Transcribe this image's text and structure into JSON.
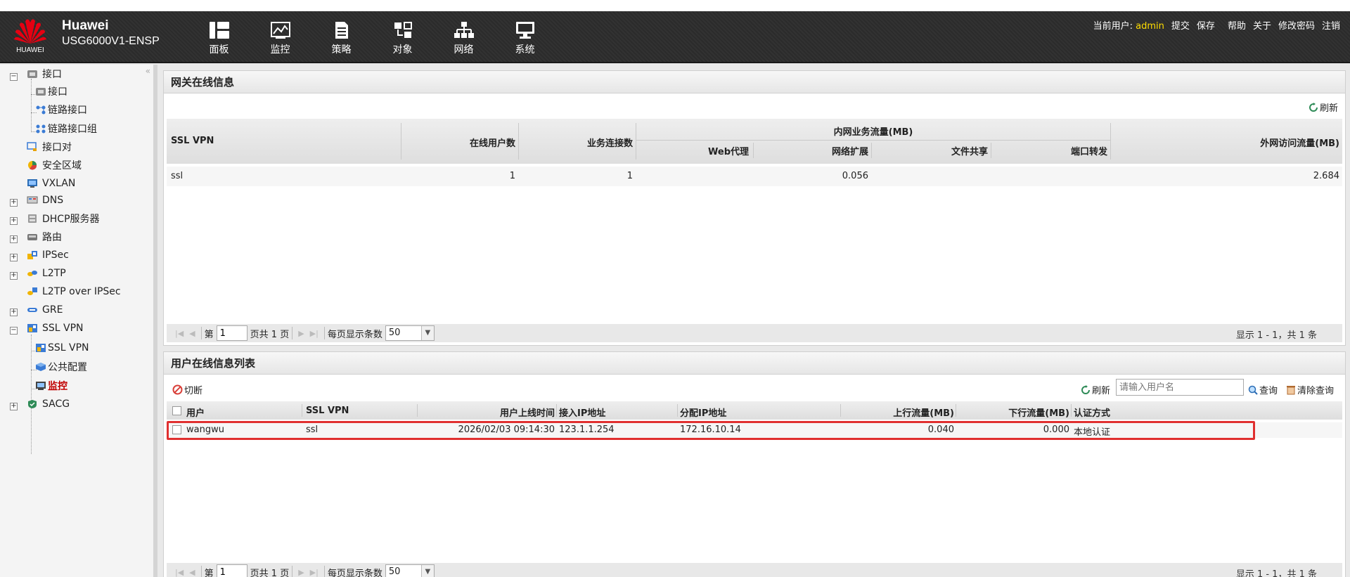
{
  "app": {
    "brand": "Huawei",
    "model": "USG6000V1-ENSP",
    "logo_text": "HUAWEI"
  },
  "nav": [
    {
      "label": "面板",
      "icon": "dashboard-icon"
    },
    {
      "label": "监控",
      "icon": "monitor-icon"
    },
    {
      "label": "策略",
      "icon": "policy-icon"
    },
    {
      "label": "对象",
      "icon": "object-icon"
    },
    {
      "label": "网络",
      "icon": "network-icon"
    },
    {
      "label": "系统",
      "icon": "system-icon"
    }
  ],
  "toplinks": {
    "current_user_label": "当前用户:",
    "username": "admin",
    "submit": "提交",
    "save": "保存",
    "help": "帮助",
    "about": "关于",
    "change_password": "修改密码",
    "logout": "注销"
  },
  "sidebar": {
    "items": [
      {
        "label": "接口"
      },
      {
        "label": "接口"
      },
      {
        "label": "链路接口"
      },
      {
        "label": "链路接口组"
      },
      {
        "label": "接口对"
      },
      {
        "label": "安全区域"
      },
      {
        "label": "VXLAN"
      },
      {
        "label": "DNS"
      },
      {
        "label": "DHCP服务器"
      },
      {
        "label": "路由"
      },
      {
        "label": "IPSec"
      },
      {
        "label": "L2TP"
      },
      {
        "label": "L2TP over IPSec"
      },
      {
        "label": "GRE"
      },
      {
        "label": "SSL VPN"
      },
      {
        "label": "SSL VPN"
      },
      {
        "label": "公共配置"
      },
      {
        "label": "监控"
      },
      {
        "label": "SACG"
      }
    ],
    "toggle_collapsed": "+",
    "toggle_expanded": "−",
    "collapse_arrows": "«"
  },
  "gateway": {
    "title": "网关在线信息",
    "refresh": "刷新",
    "headers": {
      "sslvpn": "SSL VPN",
      "online_users": "在线用户数",
      "connections": "业务连接数",
      "intranet_traffic": "内网业务流量(MB)",
      "web_proxy": "Web代理",
      "net_extend": "网络扩展",
      "file_share": "文件共享",
      "port_forward": "端口转发",
      "external_traffic": "外网访问流量(MB)"
    },
    "rows": [
      {
        "name": "ssl",
        "online_users": "1",
        "connections": "1",
        "web_proxy": "",
        "net_extend": "0.056",
        "file_share": "",
        "port_forward": "",
        "external": "2.684"
      }
    ],
    "pager": {
      "page_label": "第",
      "page": "1",
      "total_label": "页共 1 页",
      "per_page_label": "每页显示条数",
      "per_page": "50",
      "summary": "显示 1 - 1，共 1 条"
    }
  },
  "users": {
    "title": "用户在线信息列表",
    "cut": "切断",
    "refresh": "刷新",
    "search_placeholder": "请输入用户名",
    "query": "查询",
    "clear_query": "清除查询",
    "headers": {
      "user": "用户",
      "sslvpn": "SSL VPN",
      "login_time": "用户上线时间",
      "access_ip": "接入IP地址",
      "assigned_ip": "分配IP地址",
      "up": "上行流量(MB)",
      "down": "下行流量(MB)",
      "auth": "认证方式"
    },
    "rows": [
      {
        "user": "wangwu",
        "sslvpn": "ssl",
        "login_time": "2026/02/03 09:14:30",
        "access_ip": "123.1.1.254",
        "assigned_ip": "172.16.10.14",
        "up": "0.040",
        "down": "0.000",
        "auth": "本地认证"
      }
    ],
    "pager": {
      "page_label": "第",
      "page": "1",
      "total_label": "页共 1 页",
      "per_page_label": "每页显示条数",
      "per_page": "50",
      "summary": "显示 1 - 1，共 1 条"
    }
  },
  "colors": {
    "header_bg": "#2b2b2b",
    "accent_red": "#c00000",
    "highlight_border": "#e03030",
    "username": "#ffdd00"
  }
}
